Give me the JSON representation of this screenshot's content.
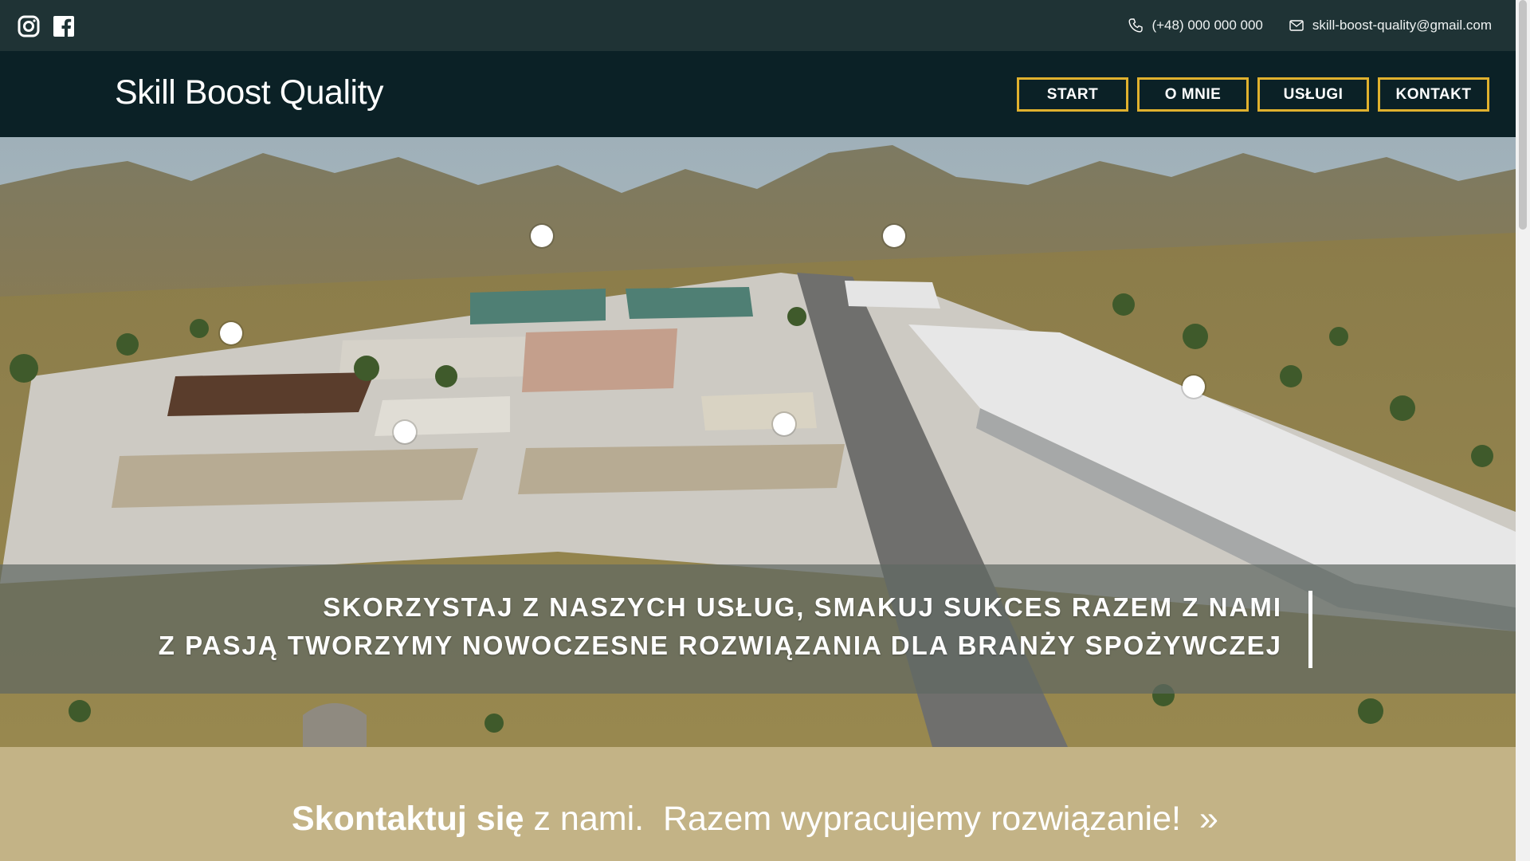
{
  "topbar": {
    "phone": "(+48) 000 000 000",
    "email": "skill-boost-quality@gmail.com",
    "social_icons": [
      "instagram-icon",
      "facebook-icon"
    ]
  },
  "header": {
    "title": "Skill Boost Quality",
    "nav": [
      {
        "label": "START"
      },
      {
        "label": "O MNIE"
      },
      {
        "label": "USŁUGI"
      },
      {
        "label": "KONTAKT"
      }
    ]
  },
  "hero": {
    "line1": "SKORZYSTAJ Z NASZYCH USŁUG, SMAKUJ SUKCES RAZEM Z NAMI",
    "line2": "Z PASJĄ TWORZYMY NOWOCZESNE ROZWIĄZANIA DLA BRANŻY SPOŻYWCZEJ",
    "hotspot_count": 6
  },
  "cta": {
    "bold": "Skontaktuj się",
    "light": " z nami.  Razem wypracujemy rozwiązanie!",
    "arrow": "»"
  },
  "colors": {
    "topbar_bg": "#1f3335",
    "header_bg": "#0b2126",
    "nav_border": "#e0b12e",
    "cta_bg": "#c3b386"
  }
}
